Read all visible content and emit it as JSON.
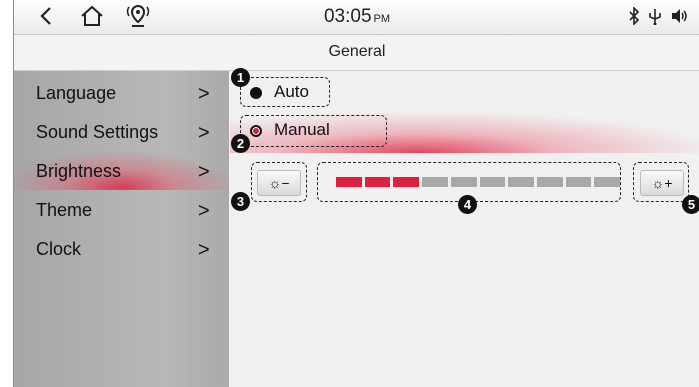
{
  "status_bar": {
    "time": "03:05",
    "ampm": "PM",
    "icons": [
      "back-arrow-icon",
      "home-icon",
      "navigation-pin-icon",
      "bluetooth-icon",
      "usb-icon",
      "volume-icon"
    ]
  },
  "title": "General",
  "sidebar": {
    "items": [
      {
        "label": "Language",
        "chevron": ">"
      },
      {
        "label": "Sound Settings",
        "chevron": ">"
      },
      {
        "label": "Brightness",
        "chevron": ">",
        "active": true
      },
      {
        "label": "Theme",
        "chevron": ">"
      },
      {
        "label": "Clock",
        "chevron": ">"
      }
    ]
  },
  "brightness": {
    "options": [
      {
        "label": "Auto",
        "selected": false
      },
      {
        "label": "Manual",
        "selected": true
      }
    ],
    "level": 3,
    "level_max": 10,
    "decrease_icon": "brightness-decrease-icon",
    "increase_icon": "brightness-increase-icon",
    "active_color": "#e02040",
    "inactive_color": "#a8a8a8"
  },
  "callouts": [
    "1",
    "2",
    "3",
    "4",
    "5"
  ]
}
